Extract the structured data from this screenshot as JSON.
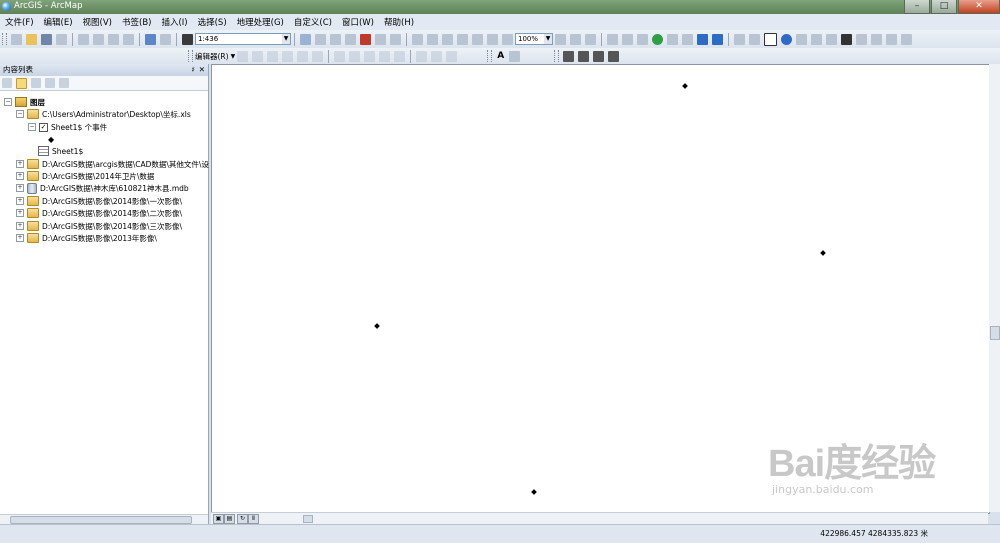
{
  "window": {
    "title": "ArcGIS - ArcMap"
  },
  "menu": [
    "文件(F)",
    "编辑(E)",
    "视图(V)",
    "书签(B)",
    "插入(I)",
    "选择(S)",
    "地理处理(G)",
    "自定义(C)",
    "窗口(W)",
    "帮助(H)"
  ],
  "toolbar": {
    "scale": "1:436",
    "zoom": "100%",
    "editor_label": "编辑器(R)"
  },
  "toc": {
    "title": "内容列表",
    "pin": "♯",
    "close": "✕",
    "root": "图层",
    "items": [
      {
        "label": "C:\\Users\\Administrator\\Desktop\\坐标.xls"
      },
      {
        "label": "Sheet1$ 个事件"
      },
      {
        "label": "Sheet1$"
      },
      {
        "label": "D:\\ArcGIS数据\\arcgis数据\\CAD数据\\其他文件\\设"
      },
      {
        "label": "D:\\ArcGIS数据\\2014年卫片\\数据"
      },
      {
        "label": "D:\\ArcGIS数据\\神木库\\610821神木县.mdb"
      },
      {
        "label": "D:\\ArcGIS数据\\影像\\2014影像\\一次影像\\"
      },
      {
        "label": "D:\\ArcGIS数据\\影像\\2014影像\\二次影像\\"
      },
      {
        "label": "D:\\ArcGIS数据\\影像\\2014影像\\三次影像\\"
      },
      {
        "label": "D:\\ArcGIS数据\\影像\\2013年影像\\"
      }
    ]
  },
  "status": {
    "coordinates": "422986.457  4284335.823 米"
  },
  "watermark": {
    "logo": "Bai度经验",
    "url": "jingyan.baidu.com"
  }
}
